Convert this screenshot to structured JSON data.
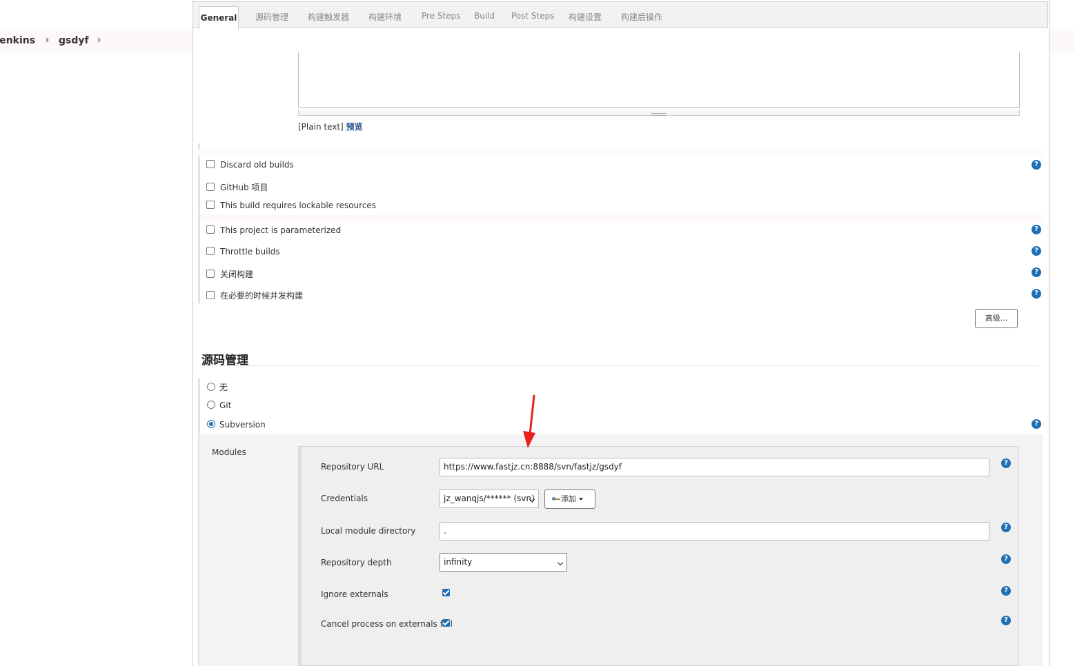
{
  "breadcrumb": {
    "items": [
      "Jenkins",
      "gsdyf"
    ]
  },
  "tabs": [
    "General",
    "源码管理",
    "构建触发器",
    "构建环境",
    "Pre Steps",
    "Build",
    "Post Steps",
    "构建设置",
    "构建后操作"
  ],
  "description": {
    "format_label": "[Plain text]",
    "preview_link": "预览"
  },
  "options_group1": [
    "Discard old builds",
    "GitHub 项目",
    "This build requires lockable resources"
  ],
  "options_group2": [
    "This project is parameterized",
    "Throttle builds",
    "关闭构建",
    "在必要的时候并发构建"
  ],
  "advanced_button": "高级...",
  "scm": {
    "title": "源码管理",
    "options": [
      "无",
      "Git",
      "Subversion"
    ],
    "selected": "Subversion",
    "modules_label": "Modules",
    "repository_url": {
      "label": "Repository URL",
      "value": "https://www.fastjz.cn:8888/svn/fastjz/gsdyf"
    },
    "credentials": {
      "label": "Credentials",
      "value": "jz_wanqjs/****** (svn)",
      "add_label": "添加"
    },
    "local_module_directory": {
      "label": "Local module directory",
      "value": "."
    },
    "repository_depth": {
      "label": "Repository depth",
      "value": "infinity"
    },
    "ignore_externals": {
      "label": "Ignore externals",
      "checked": true
    },
    "cancel_on_externals_fail": {
      "label": "Cancel process on externals fail",
      "checked": true
    }
  },
  "help_icon_glyph": "?",
  "colors": {
    "accent": "#1f6fb5",
    "annotation_arrow": "#e8211a"
  }
}
